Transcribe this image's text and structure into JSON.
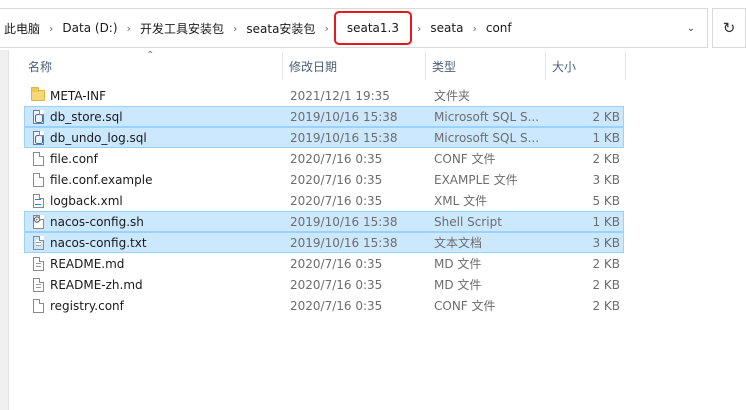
{
  "breadcrumb": {
    "items": [
      "此电脑",
      "Data (D:)",
      "开发工具安装包",
      "seata安装包",
      "seata1.3",
      "seata",
      "conf"
    ],
    "separator": "›"
  },
  "icons": {
    "refresh": "refresh-icon",
    "dropdown": "chevron-down-icon",
    "sort": "sort-ascending-icon"
  },
  "columns": {
    "name": "名称",
    "date": "修改日期",
    "type": "类型",
    "size": "大小"
  },
  "files": [
    {
      "name": "META-INF",
      "date": "2021/12/1 19:35",
      "type": "文件夹",
      "size": "",
      "icon": "folder",
      "selected": false
    },
    {
      "name": "db_store.sql",
      "date": "2019/10/16 15:38",
      "type": "Microsoft SQL S...",
      "size": "2 KB",
      "icon": "sql",
      "selected": true
    },
    {
      "name": "db_undo_log.sql",
      "date": "2019/10/16 15:38",
      "type": "Microsoft SQL S...",
      "size": "1 KB",
      "icon": "sql",
      "selected": true
    },
    {
      "name": "file.conf",
      "date": "2020/7/16 0:35",
      "type": "CONF 文件",
      "size": "2 KB",
      "icon": "file",
      "selected": false
    },
    {
      "name": "file.conf.example",
      "date": "2020/7/16 0:35",
      "type": "EXAMPLE 文件",
      "size": "3 KB",
      "icon": "file",
      "selected": false
    },
    {
      "name": "logback.xml",
      "date": "2020/7/16 0:35",
      "type": "XML 文件",
      "size": "5 KB",
      "icon": "xml",
      "selected": false
    },
    {
      "name": "nacos-config.sh",
      "date": "2019/10/16 15:38",
      "type": "Shell Script",
      "size": "1 KB",
      "icon": "gear",
      "selected": true
    },
    {
      "name": "nacos-config.txt",
      "date": "2019/10/16 15:38",
      "type": "文本文档",
      "size": "3 KB",
      "icon": "text",
      "selected": true
    },
    {
      "name": "README.md",
      "date": "2020/7/16 0:35",
      "type": "MD 文件",
      "size": "2 KB",
      "icon": "text",
      "selected": false
    },
    {
      "name": "README-zh.md",
      "date": "2020/7/16 0:35",
      "type": "MD 文件",
      "size": "2 KB",
      "icon": "text",
      "selected": false
    },
    {
      "name": "registry.conf",
      "date": "2020/7/16 0:35",
      "type": "CONF 文件",
      "size": "2 KB",
      "icon": "file",
      "selected": false
    }
  ],
  "colors": {
    "selection": "#cce8ff",
    "selection_border": "#99d1ff",
    "highlight_box": "#e81818",
    "header_text": "#4c607a"
  }
}
